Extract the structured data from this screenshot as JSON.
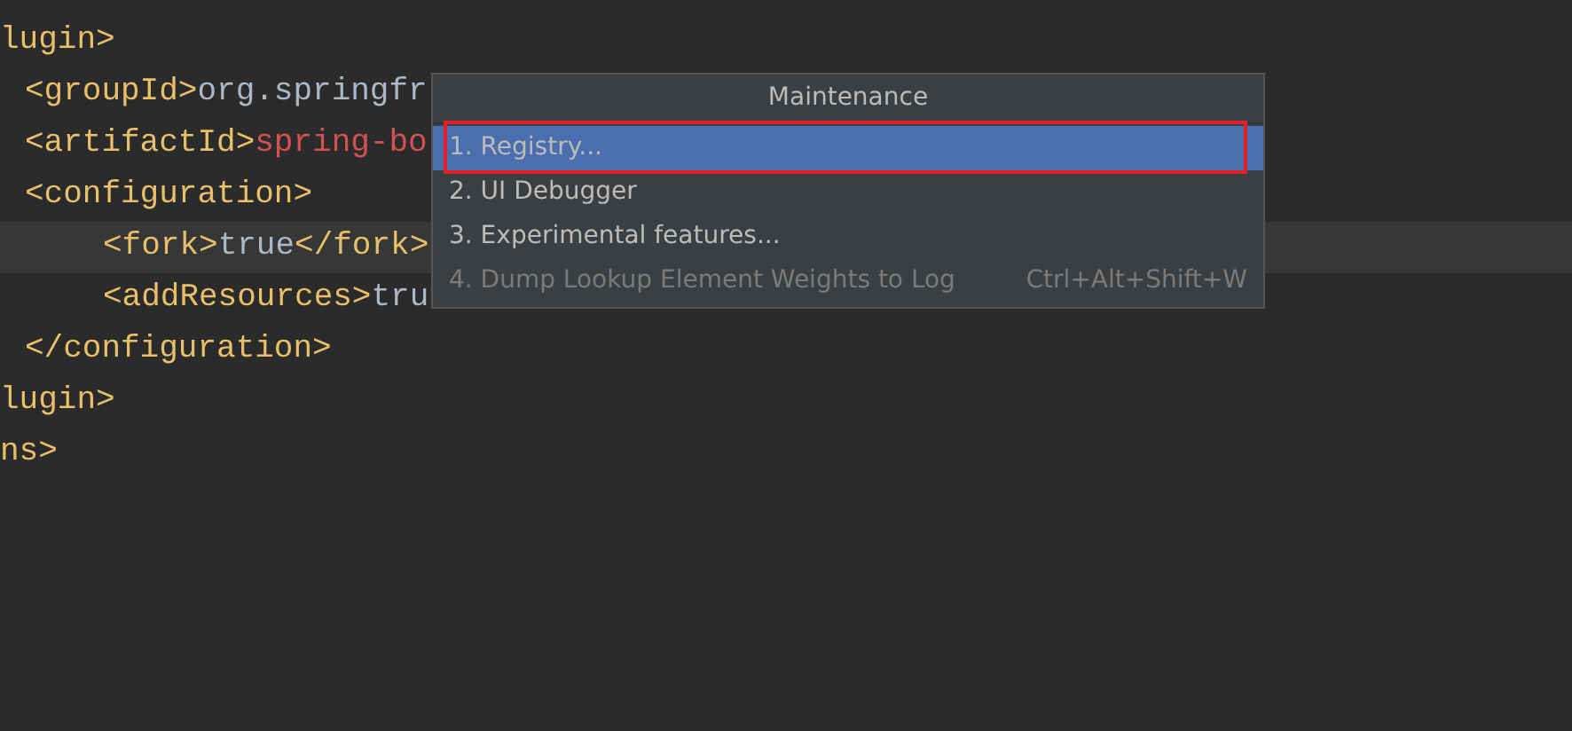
{
  "editor": {
    "lines": [
      {
        "tokens": [
          {
            "kind": "tag",
            "text": "lugin>"
          }
        ],
        "current": false,
        "children": [
          {
            "tokens": [
              {
                "kind": "tag",
                "text": "<groupId>"
              },
              {
                "kind": "text",
                "text": "org.springfr"
              }
            ],
            "current": false
          },
          {
            "tokens": [
              {
                "kind": "tag",
                "text": "<artifactId>"
              },
              {
                "kind": "error",
                "text": "spring-bo"
              }
            ],
            "current": false
          },
          {
            "tokens": [
              {
                "kind": "tag",
                "text": "<configuration>"
              }
            ],
            "current": false,
            "children": [
              {
                "tokens": [
                  {
                    "kind": "tag",
                    "text": "<fork>"
                  },
                  {
                    "kind": "text",
                    "text": "true"
                  },
                  {
                    "kind": "tag",
                    "text": "</fork>"
                  }
                ],
                "current": true
              },
              {
                "tokens": [
                  {
                    "kind": "tag",
                    "text": "<addResources>"
                  },
                  {
                    "kind": "text",
                    "text": "tru"
                  }
                ],
                "current": false
              }
            ]
          },
          {
            "tokens": [
              {
                "kind": "tag",
                "text": "</configuration>"
              }
            ],
            "current": false
          }
        ]
      },
      {
        "tokens": [
          {
            "kind": "tag",
            "text": "lugin>"
          }
        ],
        "current": false
      },
      {
        "tokens": [
          {
            "kind": "tag",
            "text": "ns>"
          }
        ],
        "current": false
      }
    ]
  },
  "popup": {
    "title": "Maintenance",
    "items": [
      {
        "label": "1. Registry...",
        "selected": true,
        "disabled": false,
        "outlined": true
      },
      {
        "label": "2. UI Debugger",
        "selected": false,
        "disabled": false,
        "outlined": false
      },
      {
        "label": "3. Experimental features...",
        "selected": false,
        "disabled": false,
        "outlined": false
      },
      {
        "label": "4. Dump Lookup Element Weights to Log",
        "shortcut": "Ctrl+Alt+Shift+W",
        "selected": false,
        "disabled": true,
        "outlined": false
      }
    ]
  }
}
